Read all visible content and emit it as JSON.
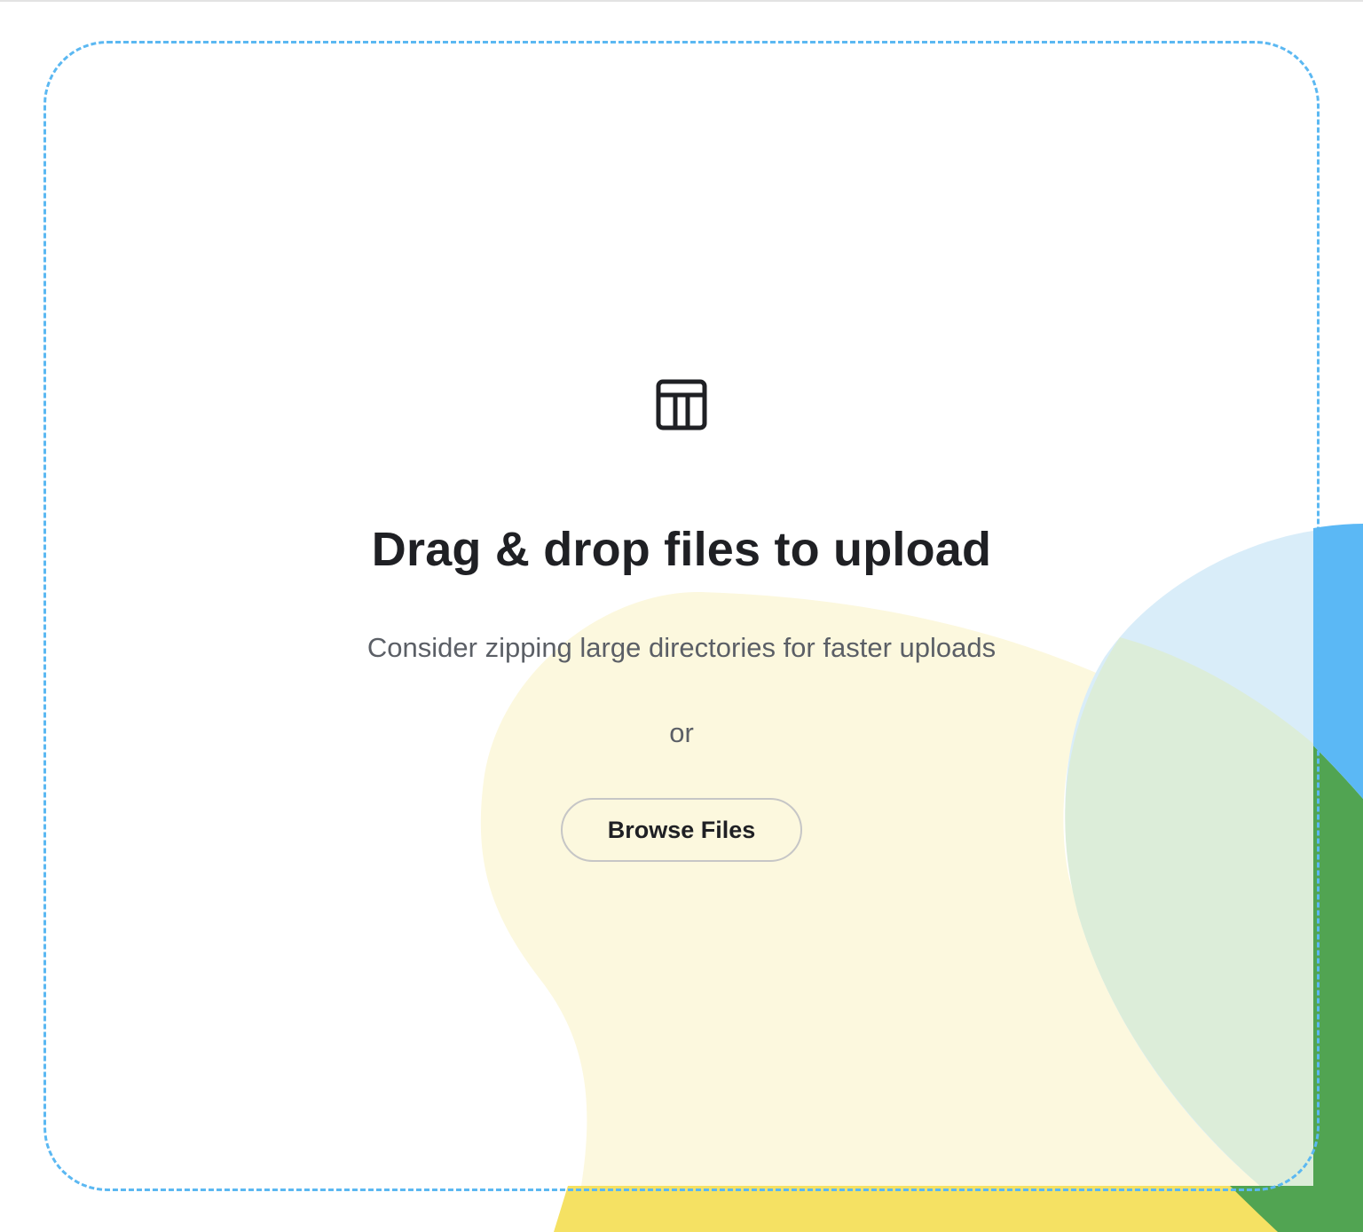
{
  "dropzone": {
    "title": "Drag & drop files to upload",
    "subtitle": "Consider zipping large directories for faster uploads",
    "separator": "or",
    "browse_label": "Browse Files",
    "icon": "table-icon"
  },
  "colors": {
    "border_accent": "#5bb8f2",
    "blob_yellow_light": "#fcf8de",
    "blob_yellow": "#f5e163",
    "blob_blue_light": "#d9edf9",
    "blob_blue": "#5bb8f5",
    "blob_green": "#51a452",
    "blob_green_light": "#dcedd9",
    "text_primary": "#1f2024",
    "text_secondary": "#5b5f66"
  }
}
